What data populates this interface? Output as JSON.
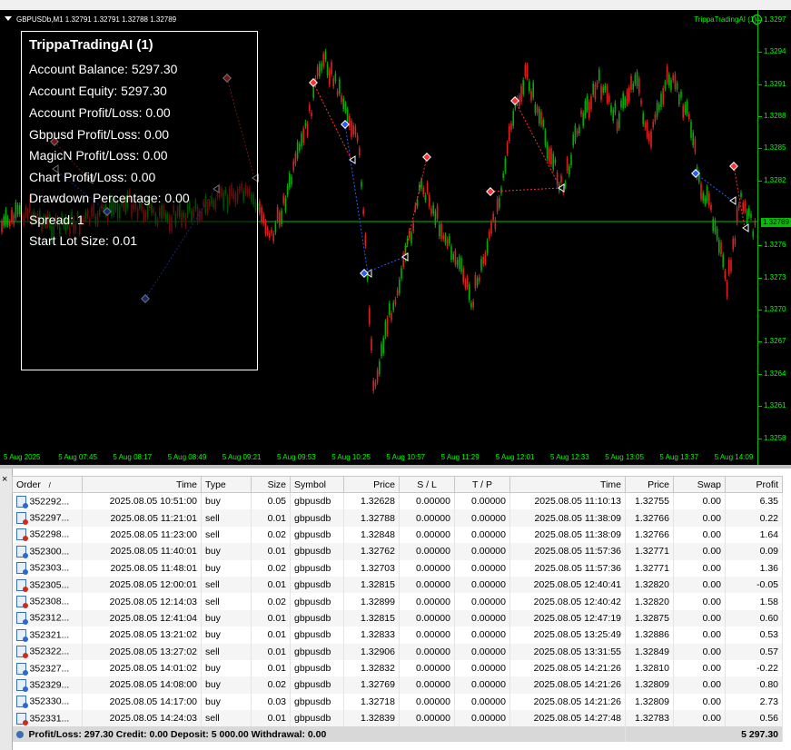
{
  "chart": {
    "symbol_header": "GBPUSDb,M1  1.32791 1.32791 1.32788 1.32789",
    "ea_label": "TrippaTradingAI (1)",
    "current_price": "1.32789",
    "y_ticks": [
      "1.3297",
      "1.3294",
      "1.3291",
      "1.3288",
      "1.3285",
      "1.3282",
      "1.3276",
      "1.3273",
      "1.3270",
      "1.3267",
      "1.3264",
      "1.3261",
      "1.3258"
    ],
    "x_ticks": [
      "5 Aug 2025",
      "5 Aug 07:45",
      "5 Aug 08:17",
      "5 Aug 08:49",
      "5 Aug 09:21",
      "5 Aug 09:53",
      "5 Aug 10:25",
      "5 Aug 10:57",
      "5 Aug 11:29",
      "5 Aug 12:01",
      "5 Aug 12:33",
      "5 Aug 13:05",
      "5 Aug 13:37",
      "5 Aug 14:09"
    ],
    "colors": {
      "background": "#000000",
      "axis": "#00ff00",
      "bull": "#00b000",
      "bear": "#e02020",
      "buy_arrow": "#2a5cff",
      "sell_arrow": "#ff3030"
    }
  },
  "panel": {
    "title": "TrippaTradingAI (1)",
    "lines": [
      "Account Balance: 5297.30",
      "Account Equity: 5297.30",
      "Account Profit/Loss: 0.00",
      "Gbpusd Profit/Loss: 0.00",
      "MagicN Profit/Loss: 0.00",
      "Chart Profit/Loss: 0.00",
      "Drawdown Percentage: 0.00",
      "Spread: 1",
      "Start Lot Size: 0.01"
    ]
  },
  "terminal": {
    "close_label": "×",
    "columns": [
      "Order",
      "Time",
      "Type",
      "Size",
      "Symbol",
      "Price",
      "S / L",
      "T / P",
      "Time",
      "Price",
      "Swap",
      "Profit"
    ],
    "sort_marker": "/",
    "rows": [
      [
        "352292...",
        "2025.08.05 10:51:00",
        "buy",
        "0.05",
        "gbpusdb",
        "1.32628",
        "0.00000",
        "0.00000",
        "2025.08.05 11:10:13",
        "1.32755",
        "0.00",
        "6.35"
      ],
      [
        "352297...",
        "2025.08.05 11:21:01",
        "sell",
        "0.01",
        "gbpusdb",
        "1.32788",
        "0.00000",
        "0.00000",
        "2025.08.05 11:38:09",
        "1.32766",
        "0.00",
        "0.22"
      ],
      [
        "352298...",
        "2025.08.05 11:23:00",
        "sell",
        "0.02",
        "gbpusdb",
        "1.32848",
        "0.00000",
        "0.00000",
        "2025.08.05 11:38:09",
        "1.32766",
        "0.00",
        "1.64"
      ],
      [
        "352300...",
        "2025.08.05 11:40:01",
        "buy",
        "0.01",
        "gbpusdb",
        "1.32762",
        "0.00000",
        "0.00000",
        "2025.08.05 11:57:36",
        "1.32771",
        "0.00",
        "0.09"
      ],
      [
        "352303...",
        "2025.08.05 11:48:01",
        "buy",
        "0.02",
        "gbpusdb",
        "1.32703",
        "0.00000",
        "0.00000",
        "2025.08.05 11:57:36",
        "1.32771",
        "0.00",
        "1.36"
      ],
      [
        "352305...",
        "2025.08.05 12:00:01",
        "sell",
        "0.01",
        "gbpusdb",
        "1.32815",
        "0.00000",
        "0.00000",
        "2025.08.05 12:40:41",
        "1.32820",
        "0.00",
        "-0.05"
      ],
      [
        "352308...",
        "2025.08.05 12:14:03",
        "sell",
        "0.02",
        "gbpusdb",
        "1.32899",
        "0.00000",
        "0.00000",
        "2025.08.05 12:40:42",
        "1.32820",
        "0.00",
        "1.58"
      ],
      [
        "352312...",
        "2025.08.05 12:41:04",
        "buy",
        "0.01",
        "gbpusdb",
        "1.32815",
        "0.00000",
        "0.00000",
        "2025.08.05 12:47:19",
        "1.32875",
        "0.00",
        "0.60"
      ],
      [
        "352321...",
        "2025.08.05 13:21:02",
        "buy",
        "0.01",
        "gbpusdb",
        "1.32833",
        "0.00000",
        "0.00000",
        "2025.08.05 13:25:49",
        "1.32886",
        "0.00",
        "0.53"
      ],
      [
        "352322...",
        "2025.08.05 13:27:02",
        "sell",
        "0.01",
        "gbpusdb",
        "1.32906",
        "0.00000",
        "0.00000",
        "2025.08.05 13:31:55",
        "1.32849",
        "0.00",
        "0.57"
      ],
      [
        "352327...",
        "2025.08.05 14:01:02",
        "buy",
        "0.01",
        "gbpusdb",
        "1.32832",
        "0.00000",
        "0.00000",
        "2025.08.05 14:21:26",
        "1.32810",
        "0.00",
        "-0.22"
      ],
      [
        "352329...",
        "2025.08.05 14:08:00",
        "buy",
        "0.02",
        "gbpusdb",
        "1.32769",
        "0.00000",
        "0.00000",
        "2025.08.05 14:21:26",
        "1.32809",
        "0.00",
        "0.80"
      ],
      [
        "352330...",
        "2025.08.05 14:17:00",
        "buy",
        "0.03",
        "gbpusdb",
        "1.32718",
        "0.00000",
        "0.00000",
        "2025.08.05 14:21:26",
        "1.32809",
        "0.00",
        "2.73"
      ],
      [
        "352331...",
        "2025.08.05 14:24:03",
        "sell",
        "0.01",
        "gbpusdb",
        "1.32839",
        "0.00000",
        "0.00000",
        "2025.08.05 14:27:48",
        "1.32783",
        "0.00",
        "0.56"
      ]
    ],
    "summary": {
      "text": "Profit/Loss: 297.30  Credit: 0.00  Deposit: 5 000.00  Withdrawal: 0.00",
      "total": "5 297.30"
    }
  }
}
